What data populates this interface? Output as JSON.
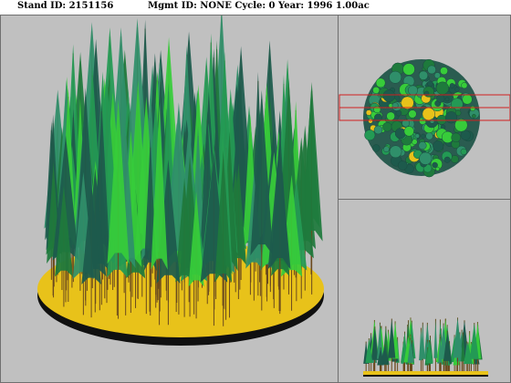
{
  "header": {
    "stand_label": "Stand ID: 2151156",
    "mgmt_label": "Mgmt ID: NONE Cycle: 0 Year: 1996 1.00ac"
  },
  "colors": {
    "background": "#c0c0c0",
    "ground": "#e8c21a",
    "ground_edge": "#101010",
    "foliage_dark": "#1d5a4c",
    "foliage_mid": "#239a54",
    "foliage_light": "#37cc3a",
    "trunk": "#6b4a1e",
    "selection": "#d02020"
  },
  "views": {
    "main": "perspective-3d-view",
    "top": "plan-view",
    "side": "profile-view"
  }
}
